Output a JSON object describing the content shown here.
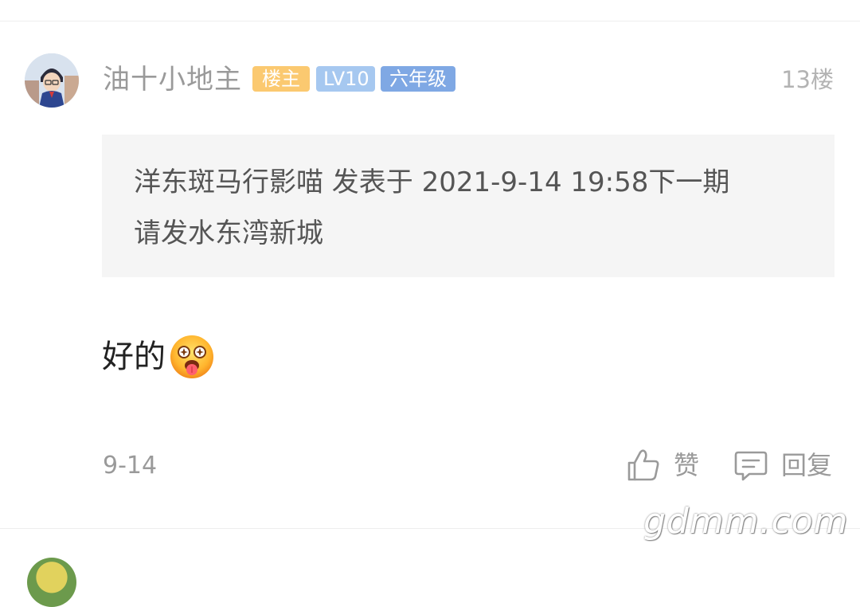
{
  "comment": {
    "username": "油十小地主",
    "badges": {
      "owner": "楼主",
      "level": "LV10",
      "grade": "六年级"
    },
    "floor": "13楼",
    "quote": {
      "line1": "洋东斑马行影喵 发表于 2021-9-14 19:58下一期",
      "line2": "请发水东湾新城"
    },
    "content": "好的",
    "content_emoji": "tongue-out-emoji",
    "date": "9-14",
    "actions": {
      "like_label": "赞",
      "reply_label": "回复"
    }
  },
  "watermark": "gdmm.com",
  "colors": {
    "owner_badge": "#fbc970",
    "level_badge": "#a6c8f0",
    "grade_badge": "#7fa8e4",
    "quote_bg": "#f5f5f5"
  }
}
